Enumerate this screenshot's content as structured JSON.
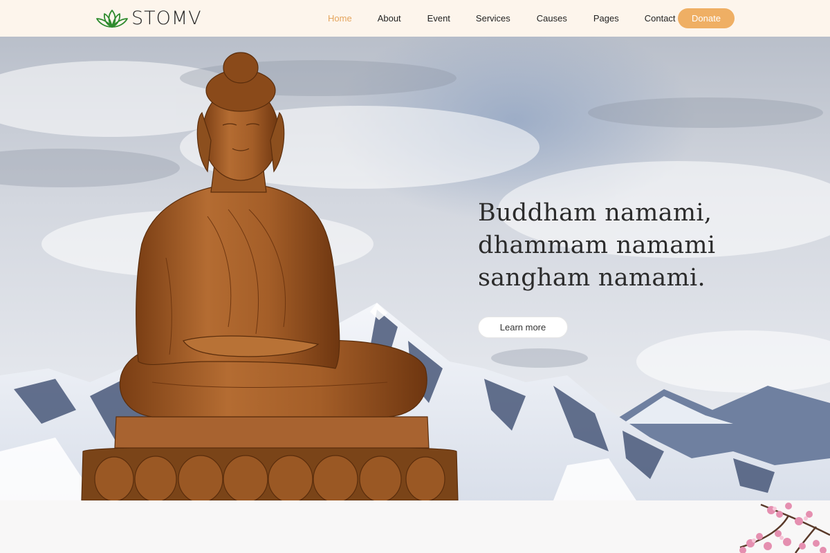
{
  "header": {
    "logo_text": "STOMV",
    "nav": [
      {
        "label": "Home",
        "active": true
      },
      {
        "label": "About"
      },
      {
        "label": "Event"
      },
      {
        "label": "Services"
      },
      {
        "label": "Causes"
      },
      {
        "label": "Pages"
      },
      {
        "label": "Contact"
      }
    ],
    "donate_label": "Donate"
  },
  "hero": {
    "title": "Buddham namami,\ndhammam namami\nsangham namami.",
    "cta_label": "Learn more"
  },
  "colors": {
    "header_bg": "#fdf5ec",
    "accent": "#efaf64",
    "active_nav": "#e5a55d",
    "logo_green": "#2e8b2e",
    "statue_bronze": "#a8612b",
    "sky": "#c9ced8",
    "snow": "#eef1f6",
    "blossom": "#e58fb0"
  },
  "icons": {
    "logo": "lotus-icon"
  }
}
